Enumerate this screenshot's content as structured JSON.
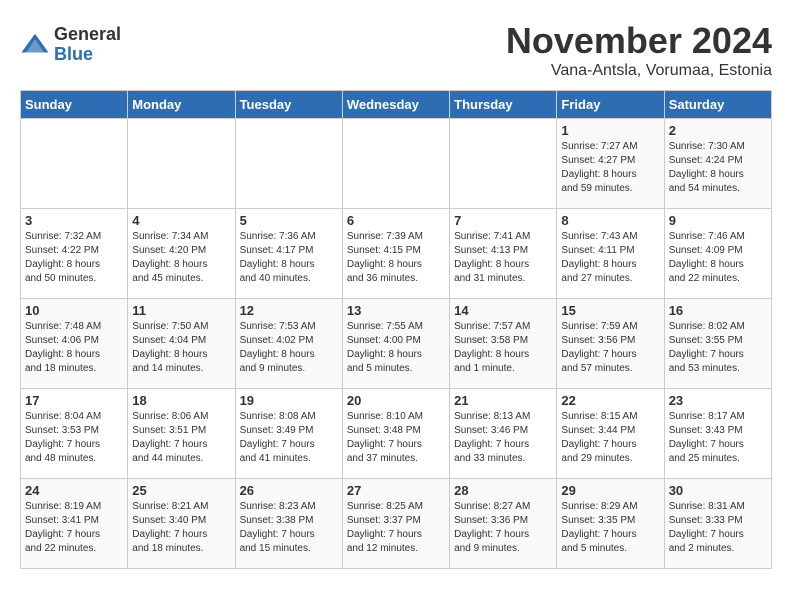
{
  "logo": {
    "general": "General",
    "blue": "Blue"
  },
  "title": "November 2024",
  "subtitle": "Vana-Antsla, Vorumaa, Estonia",
  "headers": [
    "Sunday",
    "Monday",
    "Tuesday",
    "Wednesday",
    "Thursday",
    "Friday",
    "Saturday"
  ],
  "weeks": [
    [
      {
        "day": "",
        "info": ""
      },
      {
        "day": "",
        "info": ""
      },
      {
        "day": "",
        "info": ""
      },
      {
        "day": "",
        "info": ""
      },
      {
        "day": "",
        "info": ""
      },
      {
        "day": "1",
        "info": "Sunrise: 7:27 AM\nSunset: 4:27 PM\nDaylight: 8 hours\nand 59 minutes."
      },
      {
        "day": "2",
        "info": "Sunrise: 7:30 AM\nSunset: 4:24 PM\nDaylight: 8 hours\nand 54 minutes."
      }
    ],
    [
      {
        "day": "3",
        "info": "Sunrise: 7:32 AM\nSunset: 4:22 PM\nDaylight: 8 hours\nand 50 minutes."
      },
      {
        "day": "4",
        "info": "Sunrise: 7:34 AM\nSunset: 4:20 PM\nDaylight: 8 hours\nand 45 minutes."
      },
      {
        "day": "5",
        "info": "Sunrise: 7:36 AM\nSunset: 4:17 PM\nDaylight: 8 hours\nand 40 minutes."
      },
      {
        "day": "6",
        "info": "Sunrise: 7:39 AM\nSunset: 4:15 PM\nDaylight: 8 hours\nand 36 minutes."
      },
      {
        "day": "7",
        "info": "Sunrise: 7:41 AM\nSunset: 4:13 PM\nDaylight: 8 hours\nand 31 minutes."
      },
      {
        "day": "8",
        "info": "Sunrise: 7:43 AM\nSunset: 4:11 PM\nDaylight: 8 hours\nand 27 minutes."
      },
      {
        "day": "9",
        "info": "Sunrise: 7:46 AM\nSunset: 4:09 PM\nDaylight: 8 hours\nand 22 minutes."
      }
    ],
    [
      {
        "day": "10",
        "info": "Sunrise: 7:48 AM\nSunset: 4:06 PM\nDaylight: 8 hours\nand 18 minutes."
      },
      {
        "day": "11",
        "info": "Sunrise: 7:50 AM\nSunset: 4:04 PM\nDaylight: 8 hours\nand 14 minutes."
      },
      {
        "day": "12",
        "info": "Sunrise: 7:53 AM\nSunset: 4:02 PM\nDaylight: 8 hours\nand 9 minutes."
      },
      {
        "day": "13",
        "info": "Sunrise: 7:55 AM\nSunset: 4:00 PM\nDaylight: 8 hours\nand 5 minutes."
      },
      {
        "day": "14",
        "info": "Sunrise: 7:57 AM\nSunset: 3:58 PM\nDaylight: 8 hours\nand 1 minute."
      },
      {
        "day": "15",
        "info": "Sunrise: 7:59 AM\nSunset: 3:56 PM\nDaylight: 7 hours\nand 57 minutes."
      },
      {
        "day": "16",
        "info": "Sunrise: 8:02 AM\nSunset: 3:55 PM\nDaylight: 7 hours\nand 53 minutes."
      }
    ],
    [
      {
        "day": "17",
        "info": "Sunrise: 8:04 AM\nSunset: 3:53 PM\nDaylight: 7 hours\nand 48 minutes."
      },
      {
        "day": "18",
        "info": "Sunrise: 8:06 AM\nSunset: 3:51 PM\nDaylight: 7 hours\nand 44 minutes."
      },
      {
        "day": "19",
        "info": "Sunrise: 8:08 AM\nSunset: 3:49 PM\nDaylight: 7 hours\nand 41 minutes."
      },
      {
        "day": "20",
        "info": "Sunrise: 8:10 AM\nSunset: 3:48 PM\nDaylight: 7 hours\nand 37 minutes."
      },
      {
        "day": "21",
        "info": "Sunrise: 8:13 AM\nSunset: 3:46 PM\nDaylight: 7 hours\nand 33 minutes."
      },
      {
        "day": "22",
        "info": "Sunrise: 8:15 AM\nSunset: 3:44 PM\nDaylight: 7 hours\nand 29 minutes."
      },
      {
        "day": "23",
        "info": "Sunrise: 8:17 AM\nSunset: 3:43 PM\nDaylight: 7 hours\nand 25 minutes."
      }
    ],
    [
      {
        "day": "24",
        "info": "Sunrise: 8:19 AM\nSunset: 3:41 PM\nDaylight: 7 hours\nand 22 minutes."
      },
      {
        "day": "25",
        "info": "Sunrise: 8:21 AM\nSunset: 3:40 PM\nDaylight: 7 hours\nand 18 minutes."
      },
      {
        "day": "26",
        "info": "Sunrise: 8:23 AM\nSunset: 3:38 PM\nDaylight: 7 hours\nand 15 minutes."
      },
      {
        "day": "27",
        "info": "Sunrise: 8:25 AM\nSunset: 3:37 PM\nDaylight: 7 hours\nand 12 minutes."
      },
      {
        "day": "28",
        "info": "Sunrise: 8:27 AM\nSunset: 3:36 PM\nDaylight: 7 hours\nand 9 minutes."
      },
      {
        "day": "29",
        "info": "Sunrise: 8:29 AM\nSunset: 3:35 PM\nDaylight: 7 hours\nand 5 minutes."
      },
      {
        "day": "30",
        "info": "Sunrise: 8:31 AM\nSunset: 3:33 PM\nDaylight: 7 hours\nand 2 minutes."
      }
    ]
  ]
}
